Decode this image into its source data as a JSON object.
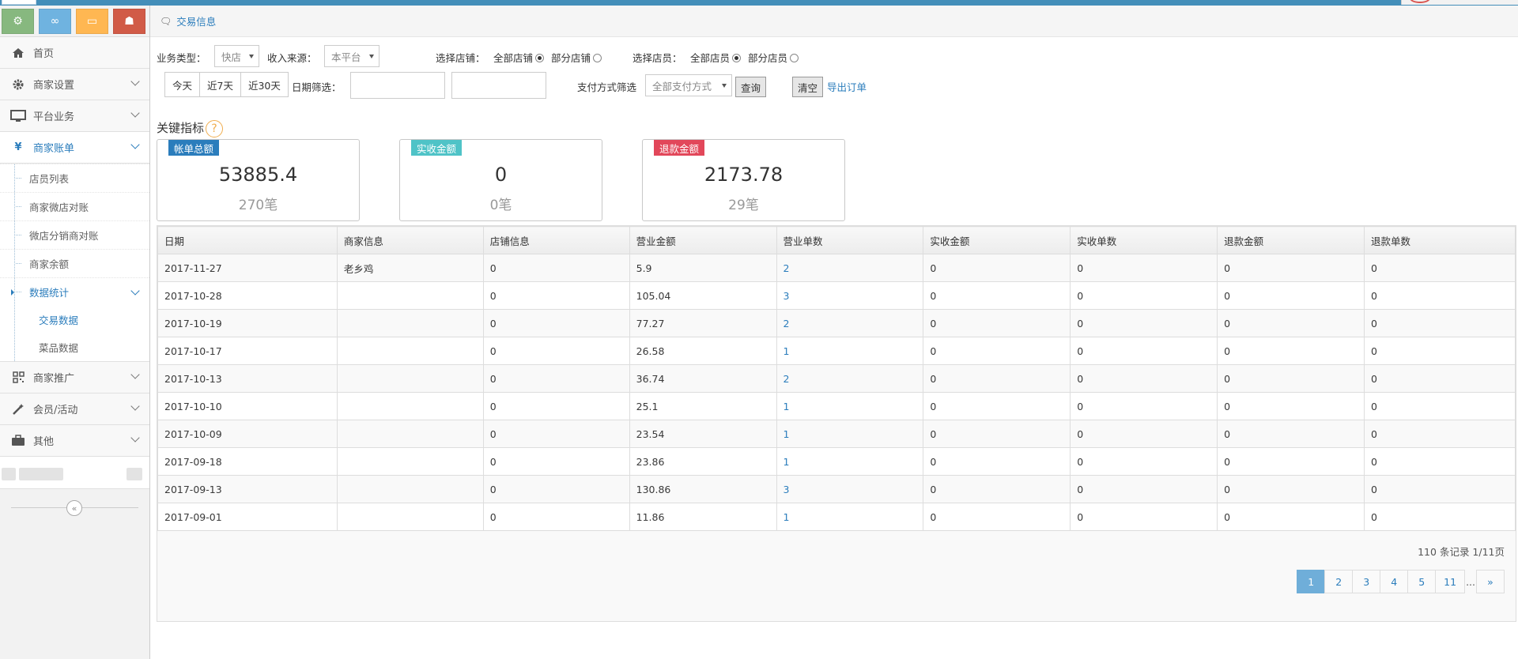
{
  "colors": {
    "shortcut1": "#87b87f",
    "shortcut2": "#6fb3e0",
    "shortcut3": "#ffb752",
    "shortcut4": "#d15b47",
    "accent": "#2b7dbc",
    "tag1": "#2b7dbc",
    "tag2": "#4fc3c7",
    "tag3": "#e2475a"
  },
  "shortcuts": [
    {
      "icon": "cog-icon",
      "glyph": "⚙"
    },
    {
      "icon": "link-icon",
      "glyph": "∞"
    },
    {
      "icon": "monitor-icon",
      "glyph": "▭"
    },
    {
      "icon": "users-icon",
      "glyph": "☗"
    }
  ],
  "sidebar": {
    "home": "首页",
    "merchant_settings": "商家设置",
    "platform": "平台业务",
    "billing": "商家账单",
    "billing_sub": [
      "店员列表",
      "商家微店对账",
      "微店分销商对账",
      "商家余额",
      "数据统计"
    ],
    "stats_sub": [
      "交易数据",
      "菜品数据"
    ],
    "promo": "商家推广",
    "member": "会员/活动",
    "other": "其他"
  },
  "breadcrumb": "交易信息",
  "filters": {
    "biz_type_label": "业务类型：",
    "biz_type": "快店",
    "income_label": "收入来源：",
    "income": "本平台",
    "store_label": "选择店铺：",
    "store_all": "全部店铺",
    "store_part": "部分店铺",
    "clerk_label": "选择店员：",
    "clerk_all": "全部店员",
    "clerk_part": "部分店员",
    "today": "今天",
    "last7": "近7天",
    "last30": "近30天",
    "date_label": "日期筛选：",
    "pay_label": "支付方式筛选",
    "pay": "全部支付方式",
    "query": "查询",
    "clear": "清空",
    "export": "导出订单"
  },
  "kpi": {
    "title": "关键指标",
    "help": "?",
    "cards": [
      {
        "tag": "帐单总额",
        "value": "53885.4",
        "count": "270笔"
      },
      {
        "tag": "实收金额",
        "value": "0",
        "count": "0笔"
      },
      {
        "tag": "退款金额",
        "value": "2173.78",
        "count": "29笔"
      }
    ]
  },
  "table": {
    "headers": [
      "日期",
      "商家信息",
      "店铺信息",
      "营业金额",
      "营业单数",
      "实收金额",
      "实收单数",
      "退款金额",
      "退款单数"
    ],
    "rows": [
      [
        "2017-11-27",
        "老乡鸡",
        "0",
        "5.9",
        "2",
        "0",
        "0",
        "0",
        "0"
      ],
      [
        "2017-10-28",
        "",
        "0",
        "105.04",
        "3",
        "0",
        "0",
        "0",
        "0"
      ],
      [
        "2017-10-19",
        "",
        "0",
        "77.27",
        "2",
        "0",
        "0",
        "0",
        "0"
      ],
      [
        "2017-10-17",
        "",
        "0",
        "26.58",
        "1",
        "0",
        "0",
        "0",
        "0"
      ],
      [
        "2017-10-13",
        "",
        "0",
        "36.74",
        "2",
        "0",
        "0",
        "0",
        "0"
      ],
      [
        "2017-10-10",
        "",
        "0",
        "25.1",
        "1",
        "0",
        "0",
        "0",
        "0"
      ],
      [
        "2017-10-09",
        "",
        "0",
        "23.54",
        "1",
        "0",
        "0",
        "0",
        "0"
      ],
      [
        "2017-09-18",
        "",
        "0",
        "23.86",
        "1",
        "0",
        "0",
        "0",
        "0"
      ],
      [
        "2017-09-13",
        "",
        "0",
        "130.86",
        "3",
        "0",
        "0",
        "0",
        "0"
      ],
      [
        "2017-09-01",
        "",
        "0",
        "11.86",
        "1",
        "0",
        "0",
        "0",
        "0"
      ]
    ]
  },
  "records": "110 条记录 1/11页",
  "pager": [
    "1",
    "2",
    "3",
    "4",
    "5",
    "11",
    "...",
    "»"
  ]
}
